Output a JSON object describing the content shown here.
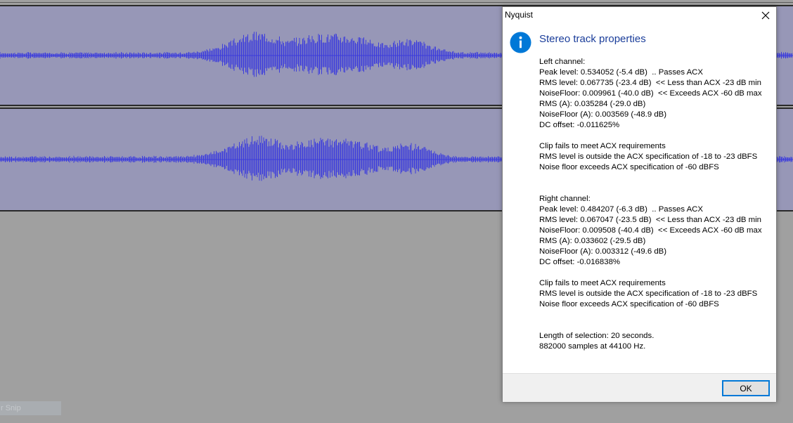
{
  "dialog": {
    "title": "Nyquist",
    "heading": "Stereo track properties",
    "left": {
      "header": "Left channel:",
      "peak": "Peak level: 0.534052 (-5.4 dB)  .. Passes ACX",
      "rms": "RMS level: 0.067735 (-23.4 dB)  << Less than ACX -23 dB min",
      "noise": "NoiseFloor: 0.009961 (-40.0 dB)  << Exceeds ACX -60 dB max",
      "rms_a": "RMS (A): 0.035284 (-29.0 dB)",
      "noise_a": "NoiseFloor (A): 0.003569 (-48.9 dB)",
      "dc": "DC offset: -0.011625%",
      "fail": "Clip fails to meet ACX requirements",
      "rms_spec": "RMS level is outside the ACX specification of -18 to -23 dBFS",
      "noise_spec": "Noise floor exceeds ACX specification of -60 dBFS"
    },
    "right": {
      "header": "Right channel:",
      "peak": "Peak level: 0.484207 (-6.3 dB)  .. Passes ACX",
      "rms": "RMS level: 0.067047 (-23.5 dB)  << Less than ACX -23 dB min",
      "noise": "NoiseFloor: 0.009508 (-40.4 dB)  << Exceeds ACX -60 dB max",
      "rms_a": "RMS (A): 0.033602 (-29.5 dB)",
      "noise_a": "NoiseFloor (A): 0.003312 (-49.6 dB)",
      "dc": "DC offset: -0.016838%",
      "fail": "Clip fails to meet ACX requirements",
      "rms_spec": "RMS level is outside the ACX specification of -18 to -23 dBFS",
      "noise_spec": "Noise floor exceeds ACX specification of -60 dBFS"
    },
    "length": "Length of selection: 20 seconds.",
    "samples": "882000 samples at 44100 Hz.",
    "ok_label": "OK"
  },
  "background": {
    "snip_hint": "r Snip"
  },
  "colors": {
    "waveform": "#3c3cdc",
    "track_bg": "#9797b7",
    "heading": "#1a3d9a",
    "info_icon": "#0078d7"
  }
}
